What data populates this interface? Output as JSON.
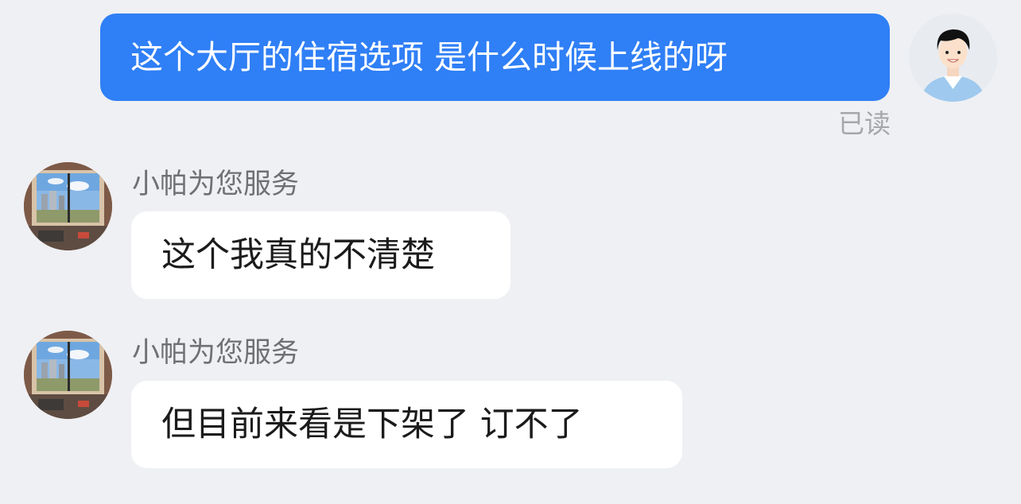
{
  "chat": {
    "messages": [
      {
        "direction": "outgoing",
        "text": "这个大厅的住宿选项 是什么时候上线的呀",
        "status": "已读",
        "avatar_icon": "user-avatar-icon"
      },
      {
        "direction": "incoming",
        "sender": "小帕为您服务",
        "text": "这个我真的不清楚",
        "avatar_icon": "agent-avatar-icon"
      },
      {
        "direction": "incoming",
        "sender": "小帕为您服务",
        "text": "但目前来看是下架了 订不了",
        "avatar_icon": "agent-avatar-icon"
      }
    ]
  },
  "colors": {
    "background": "#eff0f3",
    "outgoing_bubble": "#2f7ff6",
    "incoming_bubble": "#ffffff",
    "read_status": "#a5a7ab"
  }
}
